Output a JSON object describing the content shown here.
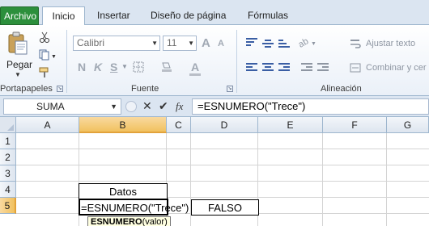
{
  "ribbon_tabs": {
    "file": "Archivo",
    "home": "Inicio",
    "insert": "Insertar",
    "page_layout": "Diseño de página",
    "formulas": "Fórmulas"
  },
  "clipboard": {
    "paste_label": "Pegar",
    "group_label": "Portapapeles"
  },
  "font": {
    "font_name": "Calibri",
    "font_size": "11",
    "bold": "N",
    "italic": "K",
    "underline": "S",
    "grow_font": "A",
    "shrink_font": "A",
    "font_color": "A",
    "group_label": "Fuente"
  },
  "alignment": {
    "wrap_text": "Ajustar texto",
    "merge_center": "Combinar y cer",
    "group_label": "Alineación"
  },
  "formula_bar": {
    "name_box": "SUMA",
    "fx_label": "fx",
    "formula": "=ESNUMERO(\"Trece\")"
  },
  "columns": [
    "A",
    "B",
    "C",
    "D",
    "E",
    "F",
    "G"
  ],
  "rows": [
    "1",
    "2",
    "3",
    "4",
    "5"
  ],
  "cells": {
    "B4": "Datos",
    "B5": "=ESNUMERO(\"Trece\")",
    "D5": "FALSO"
  },
  "tooltip": {
    "func": "ESNUMERO",
    "args": "(valor)"
  }
}
